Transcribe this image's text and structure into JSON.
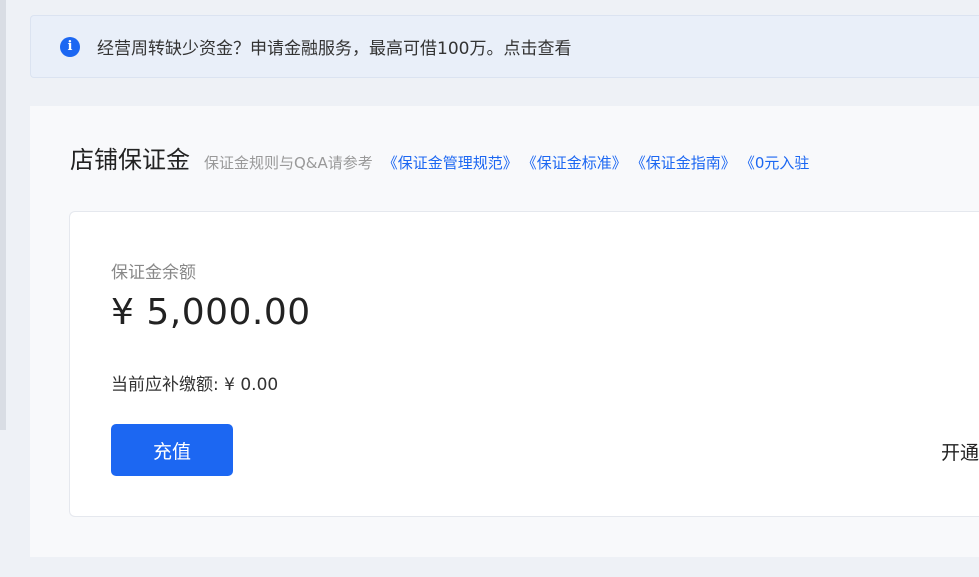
{
  "notice": {
    "text": "经营周转缺少资金？申请金融服务，最高可借100万。点击查看",
    "icon": "info-icon"
  },
  "deposit": {
    "title": "店铺保证金",
    "hint": "保证金规则与Q&A请参考",
    "links": [
      "《保证金管理规范》",
      "《保证金标准》",
      "《保证金指南》",
      "《0元入驻"
    ],
    "balance_label": "保证金余额",
    "balance_value": "¥ 5,000.00",
    "due_label": "当前应补缴额: ¥ 0.00",
    "recharge_label": "充值",
    "open_label": "开通"
  },
  "colors": {
    "accent": "#1c67f2",
    "notice_bg": "#e9eff9"
  }
}
